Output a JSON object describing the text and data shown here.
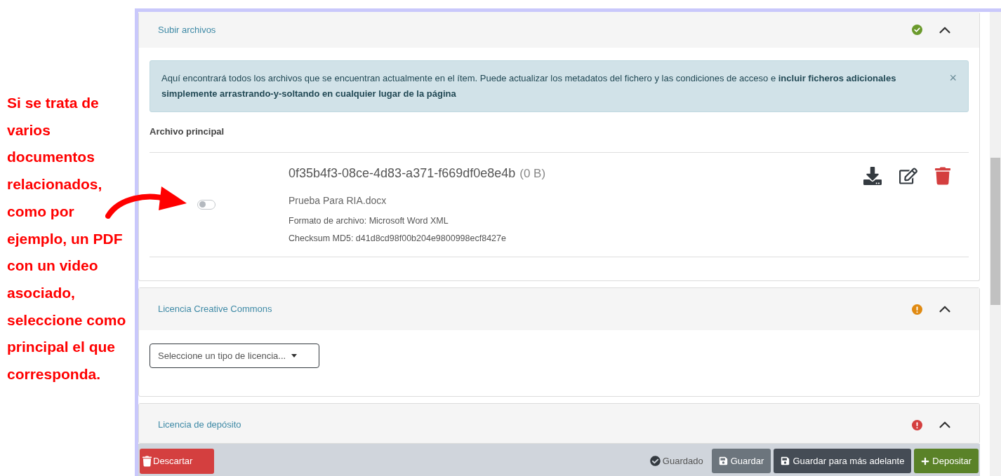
{
  "annotation": {
    "text": "Si se trata de varios documentos relacionados, como por ejemplo, un PDF con un video asociado, seleccione como principal el que corresponda."
  },
  "sections": [
    {
      "kind": "upload",
      "title": "Subir archivos",
      "status": {
        "kind": "check",
        "color": "#6b9a2c"
      },
      "expanded": true,
      "alert": {
        "text": "Aquí encontrará todos los archivos que se encuentran actualmente en el ítem. Puede actualizar los metadatos del fichero y las condiciones de acceso e **incluir ficheros adicionales simplemente arrastrando-y-soltando en cualquier lugar de la página**",
        "dismiss": "×"
      },
      "subheading": "Archivo principal",
      "files": [
        {
          "primary": false,
          "name": "0f35b4f3-08ce-4d83-a371-f669df0e8e4b",
          "size": "(0 B)",
          "filename": "Prueba Para RIA.docx",
          "format": "Formato de archivo: Microsoft Word XML",
          "checksum": "Checksum MD5: d41d8cd98f00b204e9800998ecf8427e"
        }
      ]
    },
    {
      "kind": "license",
      "title": "Licencia Creative Commons",
      "status": {
        "kind": "exclamation",
        "color": "#e08a12"
      },
      "expanded": true,
      "select": {
        "placeholder": "Seleccione un tipo de licencia..."
      }
    },
    {
      "kind": "deposit",
      "title": "Licencia de depósito",
      "status": {
        "kind": "exclamation",
        "color": "#d43f3f"
      },
      "expanded": true
    }
  ],
  "footer": {
    "discard": "Descartar",
    "saved_status": "Guardado",
    "buttons": [
      {
        "kind": "save",
        "label": "Guardar"
      },
      {
        "kind": "save_later",
        "label": "Guardar para más adelante"
      },
      {
        "kind": "deposit",
        "label": "Depositar"
      }
    ]
  }
}
